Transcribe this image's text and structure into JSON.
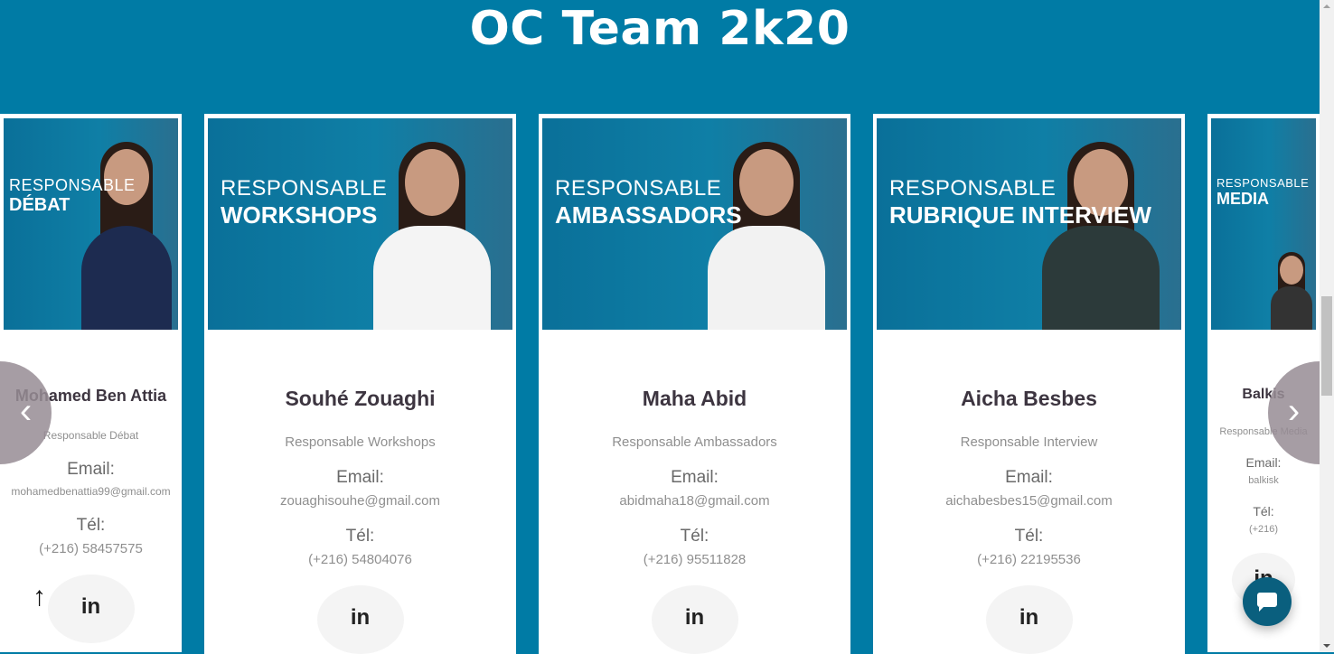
{
  "title": "OC Team 2k20",
  "members": [
    {
      "photo_l1": "RESPONSABLE",
      "photo_l2": "DÉBAT",
      "name": "Mohamed Ben Attia",
      "role": "Responsable Débat",
      "email_label": "Email:",
      "email": "mohamedbenattia99@gmail.com",
      "tel_label": "Tél:",
      "tel": "(+216) 58457575",
      "linkedin": "in",
      "suit": "#1d2b50"
    },
    {
      "photo_l1": "RESPONSABLE",
      "photo_l2": "WORKSHOPS",
      "name": "Souhé Zouaghi",
      "role": "Responsable Workshops",
      "email_label": "Email:",
      "email": "zouaghisouhe@gmail.com",
      "tel_label": "Tél:",
      "tel": "(+216) 54804076",
      "linkedin": "in",
      "suit": "#f4f4f4"
    },
    {
      "photo_l1": "RESPONSABLE",
      "photo_l2": "AMBASSADORS",
      "name": "Maha Abid",
      "role": "Responsable Ambassadors",
      "email_label": "Email:",
      "email": "abidmaha18@gmail.com",
      "tel_label": "Tél:",
      "tel": "(+216) 95511828",
      "linkedin": "in",
      "suit": "#f2f2f2"
    },
    {
      "photo_l1": "RESPONSABLE",
      "photo_l2": "RUBRIQUE INTERVIEW",
      "name": "Aicha Besbes",
      "role": "Responsable Interview",
      "email_label": "Email:",
      "email": "aichabesbes15@gmail.com",
      "tel_label": "Tél:",
      "tel": "(+216) 22195536",
      "linkedin": "in",
      "suit": "#2c3a3a"
    },
    {
      "photo_l1": "RESPONSABLE",
      "photo_l2": "MEDIA",
      "name": "Balkis",
      "role": "Responsable Media",
      "email_label": "Email:",
      "email": "balkisk",
      "tel_label": "Tél:",
      "tel": "(+216)",
      "linkedin": "in",
      "suit": "#333"
    }
  ],
  "controls": {
    "prev": "‹",
    "next": "›",
    "to_top": "↑"
  }
}
